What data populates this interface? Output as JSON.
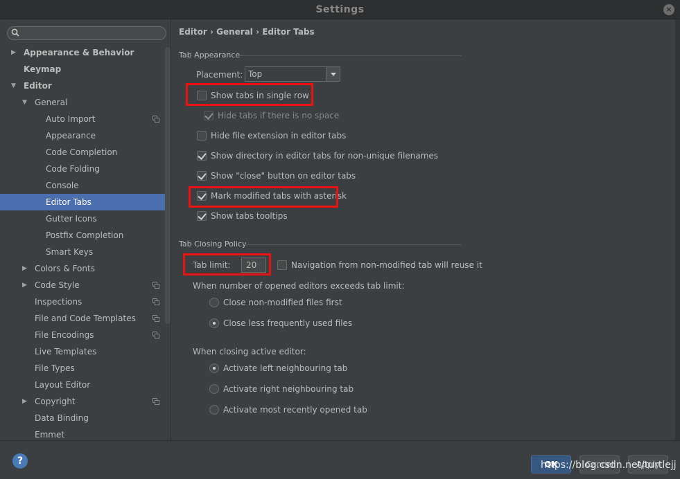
{
  "window": {
    "title": "Settings"
  },
  "search": {
    "placeholder": "",
    "value": ""
  },
  "sidebar": {
    "items": [
      {
        "label": "Appearance & Behavior",
        "level": 0,
        "arrow": "right",
        "bold": true
      },
      {
        "label": "Keymap",
        "level": 0,
        "arrow": "",
        "bold": true
      },
      {
        "label": "Editor",
        "level": 0,
        "arrow": "down",
        "bold": true
      },
      {
        "label": "General",
        "level": 1,
        "arrow": "down"
      },
      {
        "label": "Auto Import",
        "level": 2,
        "copy": true
      },
      {
        "label": "Appearance",
        "level": 2
      },
      {
        "label": "Code Completion",
        "level": 2
      },
      {
        "label": "Code Folding",
        "level": 2
      },
      {
        "label": "Console",
        "level": 2
      },
      {
        "label": "Editor Tabs",
        "level": 2,
        "selected": true
      },
      {
        "label": "Gutter Icons",
        "level": 2
      },
      {
        "label": "Postfix Completion",
        "level": 2
      },
      {
        "label": "Smart Keys",
        "level": 2
      },
      {
        "label": "Colors & Fonts",
        "level": 1,
        "arrow": "right"
      },
      {
        "label": "Code Style",
        "level": 1,
        "arrow": "right",
        "copy": true
      },
      {
        "label": "Inspections",
        "level": 1,
        "copy": true
      },
      {
        "label": "File and Code Templates",
        "level": 1,
        "copy": true
      },
      {
        "label": "File Encodings",
        "level": 1,
        "copy": true
      },
      {
        "label": "Live Templates",
        "level": 1
      },
      {
        "label": "File Types",
        "level": 1
      },
      {
        "label": "Layout Editor",
        "level": 1
      },
      {
        "label": "Copyright",
        "level": 1,
        "arrow": "right",
        "copy": true
      },
      {
        "label": "Data Binding",
        "level": 1
      },
      {
        "label": "Emmet",
        "level": 1
      }
    ]
  },
  "breadcrumb": {
    "text": "Editor › General › Editor Tabs"
  },
  "tab_appearance": {
    "title": "Tab Appearance",
    "placement_label": "Placement:",
    "placement_value": "Top",
    "options": [
      {
        "label": "Show tabs in single row",
        "checked": false,
        "disabled": false
      },
      {
        "label": "Hide tabs if there is no space",
        "checked": true,
        "disabled": true
      },
      {
        "label": "Hide file extension in editor tabs",
        "checked": false,
        "disabled": false
      },
      {
        "label": "Show directory in editor tabs for non-unique filenames",
        "checked": true,
        "disabled": false
      },
      {
        "label": "Show \"close\" button on editor tabs",
        "checked": true,
        "disabled": false
      },
      {
        "label": "Mark modified tabs with asterisk",
        "checked": true,
        "disabled": false
      },
      {
        "label": "Show tabs tooltips",
        "checked": true,
        "disabled": false
      }
    ]
  },
  "tab_closing": {
    "title": "Tab Closing Policy",
    "tab_limit_label": "Tab limit:",
    "tab_limit_value": "20",
    "nav_reuse_label": "Navigation from non-modified tab will reuse it",
    "nav_reuse_checked": false,
    "exceeds_label": "When number of opened editors exceeds tab limit:",
    "exceeds_options": [
      {
        "label": "Close non-modified files first",
        "selected": false
      },
      {
        "label": "Close less frequently used files",
        "selected": true
      }
    ],
    "closing_label": "When closing active editor:",
    "closing_options": [
      {
        "label": "Activate left neighbouring tab",
        "selected": true
      },
      {
        "label": "Activate right neighbouring tab",
        "selected": false
      },
      {
        "label": "Activate most recently opened tab",
        "selected": false
      }
    ]
  },
  "footer": {
    "help": "?",
    "ok": "OK",
    "cancel": "Cancel",
    "apply": "Apply",
    "watermark": "https://blog.csdn.net/turtlejj"
  },
  "colors": {
    "selection": "#4b6eaf",
    "highlight": "#ee1111",
    "background": "#3c3f41"
  }
}
